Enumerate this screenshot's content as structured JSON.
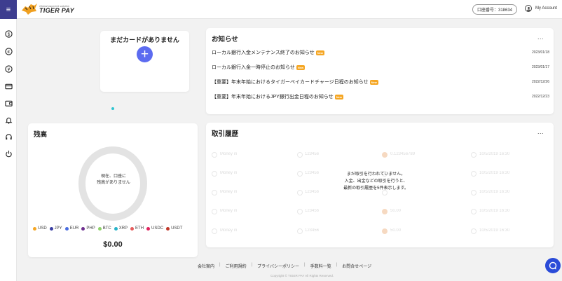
{
  "app": {
    "logo_sub": "Global payment solution",
    "logo_main": "TIGER PAY"
  },
  "header": {
    "account_number": "口座番号：318634",
    "my_account": "My Account"
  },
  "sidebar": {
    "menu_icon": "hamburger-icon",
    "items": [
      {
        "icon": "dollar-icon"
      },
      {
        "icon": "euro-icon"
      },
      {
        "icon": "yen-icon"
      },
      {
        "icon": "card-icon"
      },
      {
        "icon": "wallet-icon"
      },
      {
        "icon": "bell-icon"
      },
      {
        "icon": "headset-icon"
      },
      {
        "icon": "power-icon"
      }
    ]
  },
  "no_card": {
    "title": "まだカードがありません",
    "add_label": "+"
  },
  "news": {
    "title": "お知らせ",
    "more": "...",
    "badge": "New",
    "items": [
      {
        "title": "ローカル銀行入金メンテナンス終了のお知らせ",
        "date": "2023/01/18"
      },
      {
        "title": "ローカル銀行入金一時停止のお知らせ",
        "date": "2023/01/17"
      },
      {
        "title": "【重要】年末年始におけるタイガーペイカードチャージ日程のお知らせ",
        "date": "2022/12/26"
      },
      {
        "title": "【重要】年末年始におけるJPY銀行出金日程のお知らせ",
        "date": "2022/12/23"
      }
    ]
  },
  "balance": {
    "title": "残高",
    "donut_text_1": "現在、口座に",
    "donut_text_2": "残高がありません",
    "total": "$0.00",
    "legend": [
      {
        "label": "USD",
        "color": "#f5a623"
      },
      {
        "label": "JPY",
        "color": "#3b3fa3"
      },
      {
        "label": "EUR",
        "color": "#4a6ee0"
      },
      {
        "label": "PHP",
        "color": "#6e2f8f"
      },
      {
        "label": "BTC",
        "color": "#8fd16a"
      },
      {
        "label": "XRP",
        "color": "#27b3c9"
      },
      {
        "label": "ETH",
        "color": "#e65c5c"
      },
      {
        "label": "USDC",
        "color": "#e0245e"
      },
      {
        "label": "USDT",
        "color": "#c0392b"
      }
    ]
  },
  "transactions": {
    "title": "取引履歴",
    "more": "...",
    "empty_1": "まだ取引を行われていません。",
    "empty_2": "入金、出金などの取引を行うと、",
    "empty_3": "最新の取引履歴を5件表示します。",
    "rows": [
      {
        "label": "Money in",
        "amount": "123456",
        "value": "0.123456789",
        "date": "10/5/2019 16:30"
      },
      {
        "label": "Money in",
        "amount": "123456",
        "value": "",
        "date": "10/5/2019 16:30"
      },
      {
        "label": "Money in",
        "amount": "123456",
        "value": "",
        "date": "10/5/2019 16:30"
      },
      {
        "label": "Money in",
        "amount": "123456",
        "value": "50.00",
        "date": "10/5/2019 16:30"
      },
      {
        "label": "Money in",
        "amount": "123456",
        "value": "50.00",
        "date": "10/5/2019 16:30"
      }
    ]
  },
  "footer": {
    "links": [
      "会社案内",
      "ご利用規約",
      "プライバシーポリシー",
      "手数料一覧",
      "お問合せページ"
    ],
    "separator": "|",
    "copyright": "Copyright © TIGER PAY All Rights Reserved."
  }
}
